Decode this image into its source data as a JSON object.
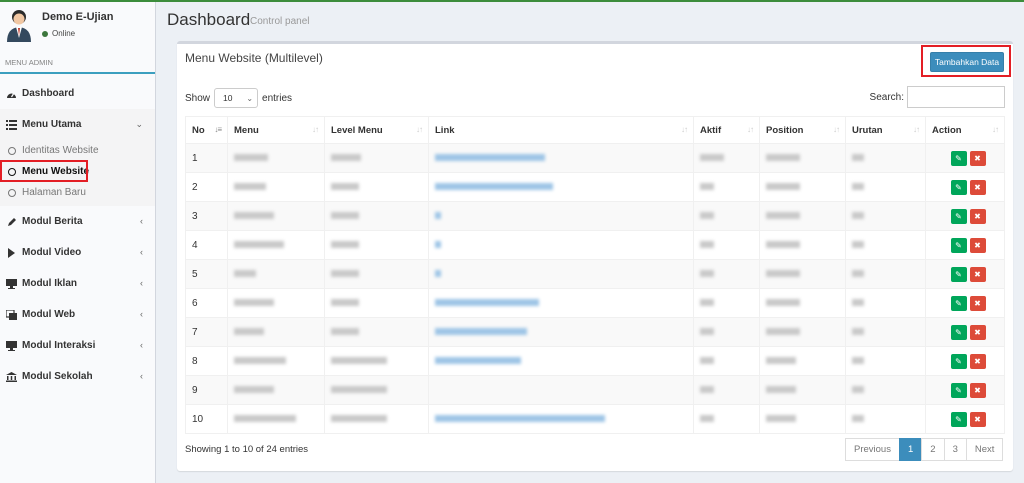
{
  "user": {
    "name": "Demo E-Ujian",
    "status": "Online"
  },
  "sidebar": {
    "header": "MENU ADMIN",
    "dashboard": "Dashboard",
    "menu_utama": "Menu Utama",
    "sub_items": [
      "Identitas Website",
      "Menu Website",
      "Halaman Baru"
    ],
    "items": [
      "Modul Berita",
      "Modul Video",
      "Modul Iklan",
      "Modul Web",
      "Modul Interaksi",
      "Modul Sekolah"
    ]
  },
  "page": {
    "title": "Dashboard",
    "subtitle": "Control panel"
  },
  "box": {
    "title": "Menu Website (Multilevel)",
    "add_label": "Tambahkan Data"
  },
  "controls": {
    "show": "Show",
    "entries_value": "10",
    "entries": "entries",
    "search": "Search:"
  },
  "table": {
    "columns": [
      "No",
      "Menu",
      "Level Menu",
      "Link",
      "Aktif",
      "Position",
      "Urutan",
      "Action"
    ],
    "rows": [
      "1",
      "2",
      "3",
      "4",
      "5",
      "6",
      "7",
      "8",
      "9",
      "10"
    ]
  },
  "footer": {
    "info": "Showing 1 to 10 of 24 entries",
    "previous": "Previous",
    "pages": [
      "1",
      "2",
      "3"
    ],
    "next": "Next"
  },
  "colors": {
    "primary": "#3c8dbc",
    "success": "#00a65a",
    "danger": "#dd4b39",
    "highlight": "#e31e25"
  }
}
